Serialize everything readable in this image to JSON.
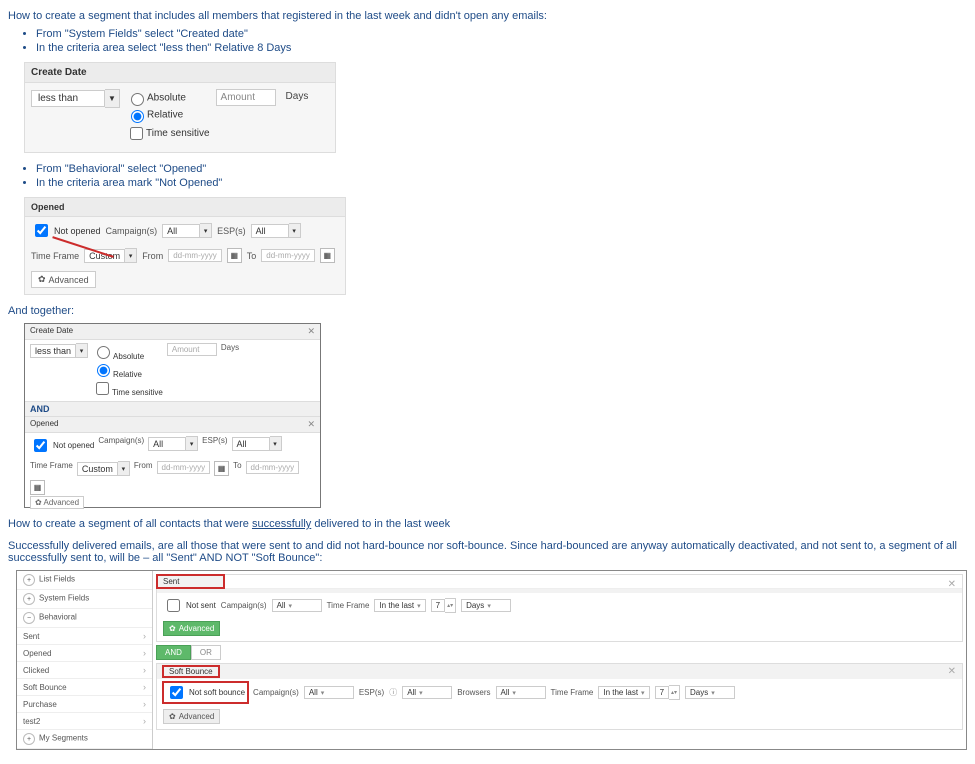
{
  "doc": {
    "heading1": "How to create a segment that includes all members that registered in the last week and didn't open any emails:",
    "bullets1": [
      "From \"System Fields\" select \"Created date\"",
      "In the criteria area select \"less then\" Relative 8 Days"
    ],
    "create_date": {
      "title": "Create Date",
      "less_than": "less than",
      "radio_absolute": "Absolute",
      "radio_relative": "Relative",
      "radio_time": "Time sensitive",
      "amount_placeholder": "Amount",
      "unit": "Days"
    },
    "bullets2": [
      "From \"Behavioral\" select \"Opened\"",
      "In the criteria area mark \"Not Opened\""
    ],
    "opened": {
      "title": "Opened",
      "not_opened": "Not opened",
      "campaigns_label": "Campaign(s)",
      "campaigns_value": "All",
      "esp_label": "ESP(s)",
      "esp_value": "All",
      "time_frame_label": "Time Frame",
      "time_frame_value": "Custom",
      "from_label": "From",
      "to_label": "To",
      "date_placeholder": "dd-mm-yyyy",
      "advanced": "Advanced"
    },
    "and_together": "And together:",
    "combined": {
      "create_date": "Create Date",
      "less_than": "less than",
      "absolute": "Absolute",
      "relative": "Relative",
      "time_sensitive": "Time sensitive",
      "amount": "Amount",
      "days": "Days",
      "and": "AND",
      "opened": "Opened",
      "not_opened": "Not opened",
      "campaigns": "Campaign(s)",
      "all": "All",
      "esp": "ESP(s)",
      "time_frame": "Time Frame",
      "custom": "Custom",
      "from": "From",
      "to": "To",
      "date_ph": "dd-mm-yyyy",
      "advanced": "Advanced"
    },
    "heading2_a": "How to create a segment of all contacts that were ",
    "heading2_b": "successfully",
    "heading2_c": " delivered to in the last week",
    "body_text": "Successfully delivered emails, are all those that were sent to and did not hard-bounce nor soft-bounce. Since hard-bounced are anyway automatically deactivated, and not sent to, a segment of all successfully sent to, will be – all \"Sent\" AND NOT \"Soft Bounce\":",
    "builder": {
      "left": {
        "list_fields": "List Fields",
        "system_fields": "System Fields",
        "behavioral": "Behavioral",
        "sent": "Sent",
        "opened": "Opened",
        "clicked": "Clicked",
        "soft_bounce": "Soft Bounce",
        "purchase": "Purchase",
        "test": "test2",
        "my_segments": "My Segments"
      },
      "sent_block": {
        "title": "Sent",
        "not_sent": "Not sent",
        "campaigns": "Campaign(s)",
        "all": "All",
        "time_frame": "Time Frame",
        "in_the_last": "In the last",
        "value": "7",
        "unit": "Days",
        "advanced": "Advanced"
      },
      "and": "AND",
      "or": "OR",
      "sb_block": {
        "title": "Soft Bounce",
        "not_sb": "Not soft bounce",
        "campaigns": "Campaign(s)",
        "all": "All",
        "esps": "ESP(s)",
        "browsers": "Browsers",
        "time_frame": "Time Frame",
        "in_the_last": "In the last",
        "value": "7",
        "unit": "Days",
        "advanced": "Advanced"
      }
    }
  }
}
